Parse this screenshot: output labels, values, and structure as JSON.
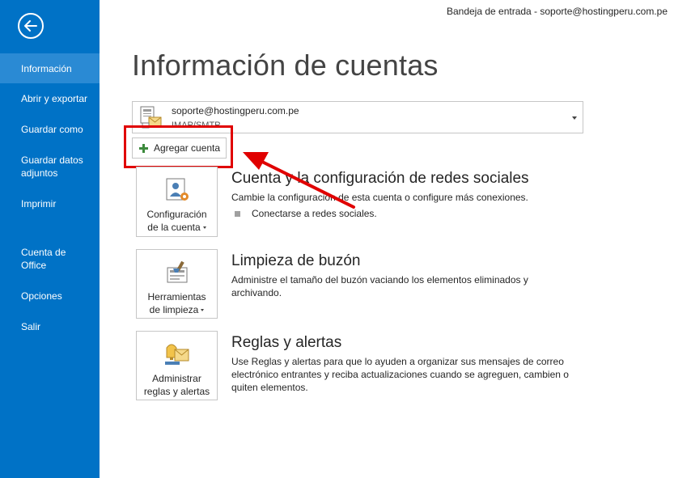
{
  "window": {
    "title": "Bandeja de entrada - soporte@hostingperu.com.pe"
  },
  "page": {
    "title": "Información de cuentas"
  },
  "sidebar": {
    "back_icon": "back-arrow-icon",
    "items": [
      {
        "label": "Información",
        "active": true
      },
      {
        "label": "Abrir y exportar"
      },
      {
        "label": "Guardar como"
      },
      {
        "label": "Guardar datos adjuntos"
      },
      {
        "label": "Imprimir"
      },
      {
        "label": "Cuenta de Office"
      },
      {
        "label": "Opciones"
      },
      {
        "label": "Salir"
      }
    ]
  },
  "account": {
    "email": "soporte@hostingperu.com.pe",
    "type": "IMAP/SMTP"
  },
  "add_account": {
    "label": "Agregar cuenta"
  },
  "sections": [
    {
      "tile_label_1": "Configuración",
      "tile_label_2": "de la cuenta",
      "title": "Cuenta y la configuración de redes sociales",
      "description": "Cambie la configuración de esta cuenta o configure más conexiones.",
      "bullet": "Conectarse a redes sociales."
    },
    {
      "tile_label_1": "Herramientas",
      "tile_label_2": "de limpieza",
      "title": "Limpieza de buzón",
      "description": "Administre el tamaño del buzón vaciando los elementos eliminados y archivando."
    },
    {
      "tile_label_1": "Administrar",
      "tile_label_2": "reglas y alertas",
      "title": "Reglas y alertas",
      "description": "Use Reglas y alertas para que lo ayuden a organizar sus mensajes de correo electrónico entrantes y reciba actualizaciones cuando se agreguen, cambien o quiten elementos."
    }
  ],
  "colors": {
    "sidebar": "#0072c6",
    "sidebar_active": "#2a8ad4",
    "annotation": "#e00000",
    "add_icon": "#3c8a3c"
  }
}
